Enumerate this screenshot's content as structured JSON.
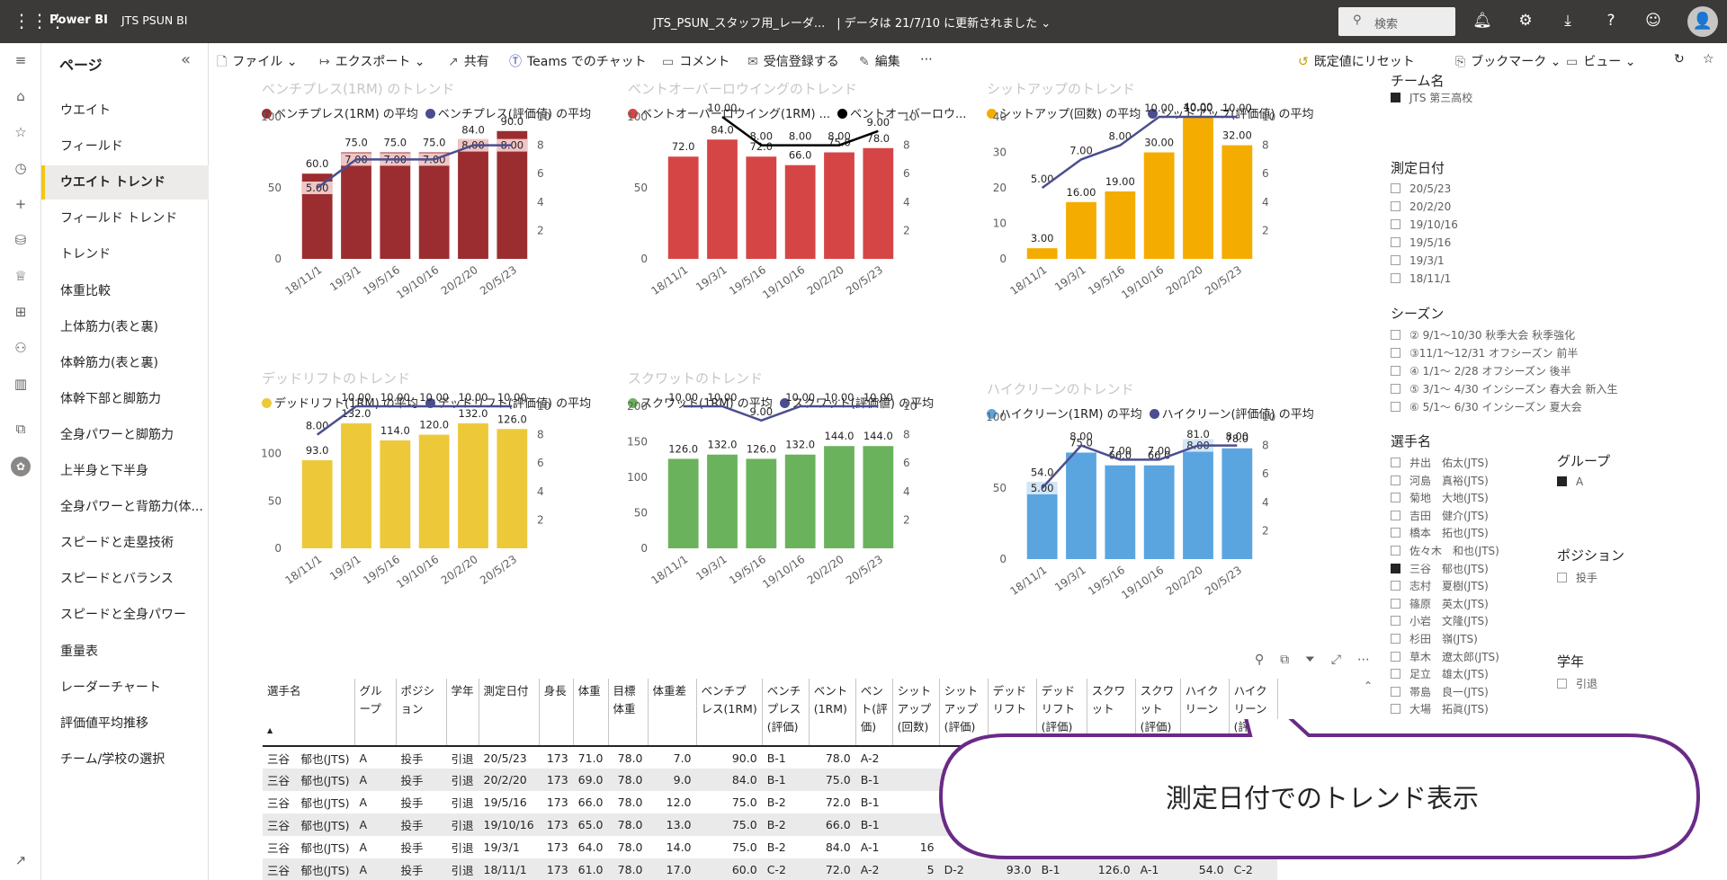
{
  "topbar": {
    "brand": "Power BI",
    "workspace": "JTS PSUN BI",
    "doc_title": "JTS_PSUN_スタッフ用_レーダ...　| データは 21/7/10 に更新されました",
    "search_placeholder": "検索",
    "avatar": "👤"
  },
  "pages": {
    "header": "ページ",
    "items": [
      "ウエイト",
      "フィールド",
      "ウエイト トレンド",
      "フィールド トレンド",
      "トレンド",
      "体重比較",
      "上体筋力(表と裏)",
      "体幹筋力(表と裏)",
      "体幹下部と脚筋力",
      "全身パワーと脚筋力",
      "上半身と下半身",
      "全身パワーと背筋力(体...",
      "スピードと走塁技術",
      "スピードとバランス",
      "スピードと全身パワー",
      "重量表",
      "レーダーチャート",
      "評価値平均推移",
      "チーム/学校の選択"
    ],
    "selected_index": 2
  },
  "toolbar": {
    "file": "ファイル",
    "export": "エクスポート",
    "share": "共有",
    "teams": "Teams でのチャット",
    "comment": "コメント",
    "subscribe": "受信登録する",
    "edit": "編集",
    "more": "⋯",
    "reset": "既定値にリセット",
    "bookmark": "ブックマーク",
    "view": "ビュー"
  },
  "chart_data": [
    {
      "id": "bench",
      "type": "bar",
      "title": "ベンチプレス(1RM) のトレンド",
      "categories": [
        "18/11/1",
        "19/3/1",
        "19/5/16",
        "19/10/16",
        "20/2/20",
        "20/5/23"
      ],
      "series": [
        {
          "name": "ベンチプレス(1RM) の平均",
          "values": [
            60.0,
            75.0,
            75.0,
            75.0,
            84.0,
            90.0
          ]
        },
        {
          "name": "ベンチプレス(評価値) の平均",
          "values": [
            5.0,
            7.0,
            7.0,
            7.0,
            8.0,
            8.0
          ]
        }
      ],
      "ylim": [
        0,
        100
      ],
      "y2lim": [
        0,
        10
      ],
      "yticks": [
        0,
        50,
        100
      ],
      "y2ticks": [
        2,
        4,
        6,
        8,
        10
      ],
      "bar_color": "#9b2d30",
      "line_color": "#4a4e8e",
      "band_color": "#f0c5c5"
    },
    {
      "id": "bentover",
      "type": "bar",
      "title": "ベントオーバーロウイングのトレンド",
      "categories": [
        "18/11/1",
        "19/3/1",
        "19/5/16",
        "19/10/16",
        "20/2/20",
        "20/5/23"
      ],
      "series": [
        {
          "name": "ベントオーバーロウイング(1RM) ...",
          "values": [
            72.0,
            84.0,
            72.0,
            66.0,
            75.0,
            78.0
          ]
        },
        {
          "name": "ベントオーバーロウ...",
          "values": [
            null,
            10.0,
            8.0,
            8.0,
            8.0,
            9.0
          ]
        }
      ],
      "ylim": [
        0,
        100
      ],
      "y2lim": [
        0,
        10
      ],
      "yticks": [
        0,
        50,
        100
      ],
      "y2ticks": [
        2,
        4,
        6,
        8,
        10
      ],
      "bar_color": "#d64545",
      "line_color": "#000000",
      "band_color": "#f0c5c5"
    },
    {
      "id": "situp",
      "type": "bar",
      "title": "シットアップのトレンド",
      "categories": [
        "18/11/1",
        "19/3/1",
        "19/5/16",
        "19/10/16",
        "20/2/20",
        "20/5/23"
      ],
      "series": [
        {
          "name": "シットアップ(回数) の平均",
          "values": [
            3.0,
            16.0,
            19.0,
            30.0,
            40.0,
            32.0
          ]
        },
        {
          "name": "シットアップ(評価値) の平均",
          "values": [
            5.0,
            7.0,
            8.0,
            10.0,
            10.0,
            10.0
          ]
        }
      ],
      "ylim": [
        0,
        40
      ],
      "y2lim": [
        0,
        10
      ],
      "yticks": [
        0,
        10,
        20,
        30,
        40
      ],
      "y2ticks": [
        2,
        4,
        6,
        8,
        10
      ],
      "bar_color": "#f4ac00",
      "line_color": "#4a4e8e",
      "band_color": "#fbe2a6"
    },
    {
      "id": "deadlift",
      "type": "bar",
      "title": "デッドリフトのトレンド",
      "categories": [
        "18/11/1",
        "19/3/1",
        "19/5/16",
        "19/10/16",
        "20/2/20",
        "20/5/23"
      ],
      "series": [
        {
          "name": "デッドリフト(1RM) の平均",
          "values": [
            93.0,
            132.0,
            114.0,
            120.0,
            132.0,
            126.0
          ]
        },
        {
          "name": "デッドリフト(評価値) の平均",
          "values": [
            8.0,
            10.0,
            10.0,
            10.0,
            10.0,
            10.0
          ]
        }
      ],
      "ylim": [
        0,
        150
      ],
      "y2lim": [
        0,
        10
      ],
      "yticks": [
        0,
        50,
        100
      ],
      "y2ticks": [
        2,
        4,
        6,
        8,
        10
      ],
      "bar_color": "#edc939",
      "line_color": "#4a4e8e",
      "band_color": "#f7e6a3"
    },
    {
      "id": "squat",
      "type": "bar",
      "title": "スクワットのトレンド",
      "categories": [
        "18/11/1",
        "19/3/1",
        "19/5/16",
        "19/10/16",
        "20/2/20",
        "20/5/23"
      ],
      "series": [
        {
          "name": "スクワット(1RM) の平均",
          "values": [
            126.0,
            132.0,
            126.0,
            132.0,
            144.0,
            144.0
          ]
        },
        {
          "name": "スクワット(評価値) の平均",
          "values": [
            10.0,
            10.0,
            9.0,
            10.0,
            10.0,
            10.0
          ]
        }
      ],
      "ylim": [
        0,
        200
      ],
      "y2lim": [
        0,
        10
      ],
      "yticks": [
        0,
        50,
        100,
        150,
        200
      ],
      "y2ticks": [
        2,
        4,
        6,
        8,
        10
      ],
      "bar_color": "#6ab35c",
      "line_color": "#4a4e8e",
      "band_color": "#cfe8c8"
    },
    {
      "id": "highclean",
      "type": "bar",
      "title": "ハイクリーンのトレンド",
      "categories": [
        "18/11/1",
        "19/3/1",
        "19/5/16",
        "19/10/16",
        "20/2/20",
        "20/5/23"
      ],
      "series": [
        {
          "name": "ハイクリーン(1RM) の平均",
          "values": [
            54.0,
            75.0,
            66.0,
            66.0,
            81.0,
            78.0
          ]
        },
        {
          "name": "ハイクリーン(評価値) の平均",
          "values": [
            5.0,
            8.0,
            7.0,
            7.0,
            8.0,
            8.0
          ]
        }
      ],
      "ylim": [
        0,
        100
      ],
      "y2lim": [
        0,
        10
      ],
      "yticks": [
        0,
        50,
        100
      ],
      "y2ticks": [
        2,
        4,
        6,
        8,
        10
      ],
      "bar_color": "#5aa5e0",
      "line_color": "#4a4e8e",
      "band_color": "#d3e6f7"
    }
  ],
  "slicers": {
    "team": {
      "title": "チーム名",
      "items": [
        "JTS 第三高校"
      ]
    },
    "date": {
      "title": "測定日付",
      "items": [
        "20/5/23",
        "20/2/20",
        "19/10/16",
        "19/5/16",
        "19/3/1",
        "18/11/1"
      ]
    },
    "season": {
      "title": "シーズン",
      "items": [
        "② 9/1～10/30 秋季大会 秋季強化",
        "③11/1～12/31 オフシーズン 前半",
        "④ 1/1～ 2/28 オフシーズン 後半",
        "⑤ 3/1～ 4/30 インシーズン 春大会 新入生",
        "⑥ 5/1～ 6/30 インシーズン 夏大会"
      ]
    },
    "player": {
      "title": "選手名",
      "items": [
        "井出　佑太(JTS)",
        "河島　真裕(JTS)",
        "菊地　大地(JTS)",
        "吉田　健介(JTS)",
        "橋本　拓也(JTS)",
        "佐々木　和也(JTS)",
        "三谷　郁也(JTS)",
        "志村　夏樹(JTS)",
        "篠原　英太(JTS)",
        "小岩　文隆(JTS)",
        "杉田　嶺(JTS)",
        "草木　遼太郎(JTS)",
        "足立　雄太(JTS)",
        "帯島　良一(JTS)",
        "大場　拓眞(JTS)"
      ],
      "checked_index": 6
    },
    "group": {
      "title": "グループ",
      "items": [
        "A"
      ]
    },
    "position": {
      "title": "ポジション",
      "items": [
        "投手"
      ]
    },
    "grade": {
      "title": "学年",
      "items": [
        "引退"
      ]
    }
  },
  "table": {
    "headers": [
      "選手名",
      "グループ",
      "ポジション",
      "学年",
      "測定日付",
      "身長",
      "体重",
      "目標体重",
      "体重差",
      "ベンチプレス(1RM)",
      "ベンチプレス(評価)",
      "ベント(1RM)",
      "ベント(評価)",
      "シットアップ(回数)",
      "シットアップ(評価)",
      "デッドリフト",
      "デッドリフト(評価)",
      "スクワット",
      "スクワット(評価)",
      "ハイクリーン",
      "ハイクリーン(評価)"
    ],
    "header_display": [
      "選手名",
      "グル\nープ",
      "ポジシ\nョン",
      "学年",
      "測定日付",
      "身長",
      "体重",
      "目標\n体重",
      "体重差",
      "ベンチプ\nレス(1RM)",
      "ベンチ\nプレス\n(評価)",
      "ベント\n(1RM)",
      "ベン\nト(評\n価)",
      "シット\nアップ\n(回数)",
      "シット\nアップ\n(評価)",
      "デッド\nリフト",
      "デッド\nリフト\n(評価)",
      "スクワ\nット",
      "スクワ\nット\n(評価)",
      "ハイク\nリーン",
      "ハイク\nリーン\n(評価)"
    ],
    "rows": [
      [
        "三谷　郁也(JTS)",
        "A",
        "投手",
        "引退",
        "20/5/23",
        "173",
        "71.0",
        "78.0",
        "7.0",
        "90.0",
        "B-1",
        "78.0",
        "A-2",
        "",
        "",
        "",
        "",
        "",
        "",
        "",
        ""
      ],
      [
        "三谷　郁也(JTS)",
        "A",
        "投手",
        "引退",
        "20/2/20",
        "173",
        "69.0",
        "78.0",
        "9.0",
        "84.0",
        "B-1",
        "75.0",
        "B-1",
        "",
        "",
        "",
        "",
        "",
        "",
        "",
        ""
      ],
      [
        "三谷　郁也(JTS)",
        "A",
        "投手",
        "引退",
        "19/5/16",
        "173",
        "66.0",
        "78.0",
        "12.0",
        "75.0",
        "B-2",
        "72.0",
        "B-1",
        "",
        "",
        "",
        "",
        "",
        "",
        "",
        ""
      ],
      [
        "三谷　郁也(JTS)",
        "A",
        "投手",
        "引退",
        "19/10/16",
        "173",
        "65.0",
        "78.0",
        "13.0",
        "75.0",
        "B-2",
        "66.0",
        "B-1",
        "",
        "",
        "",
        "",
        "",
        "",
        "",
        ""
      ],
      [
        "三谷　郁也(JTS)",
        "A",
        "投手",
        "引退",
        "19/3/1",
        "173",
        "64.0",
        "78.0",
        "14.0",
        "75.0",
        "B-2",
        "84.0",
        "A-1",
        "16",
        "",
        "",
        "",
        "",
        "",
        "",
        ""
      ],
      [
        "三谷　郁也(JTS)",
        "A",
        "投手",
        "引退",
        "18/11/1",
        "173",
        "61.0",
        "78.0",
        "17.0",
        "60.0",
        "C-2",
        "72.0",
        "A-2",
        "5",
        "D-2",
        "93.0",
        "B-1",
        "126.0",
        "A-1",
        "54.0",
        "C-2"
      ]
    ]
  },
  "callout": {
    "text": "測定日付でのトレンド表示"
  }
}
